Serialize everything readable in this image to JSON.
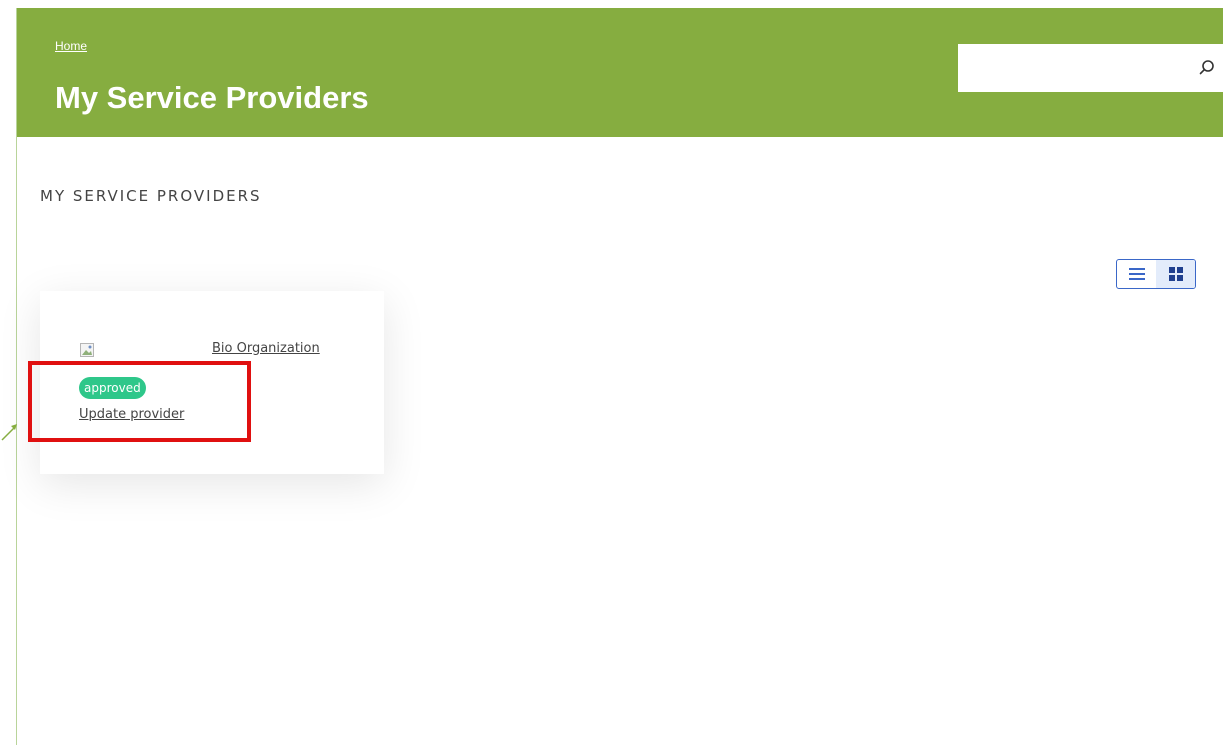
{
  "header": {
    "breadcrumb": "Home",
    "title": "My Service Providers",
    "background_color": "#86ad40"
  },
  "search": {
    "value": "",
    "placeholder": "",
    "icon": "search-icon"
  },
  "section": {
    "heading": "MY SERVICE PROVIDERS"
  },
  "view_toggle": {
    "options": [
      "list-view",
      "grid-view"
    ],
    "selected": "grid-view"
  },
  "providers": [
    {
      "name": "Bio Organization",
      "image": "broken-image-icon",
      "status": "approved",
      "status_color": "#2ec78a",
      "action_label": "Update provider"
    }
  ],
  "annotation": {
    "highlight_color": "#e01010"
  }
}
